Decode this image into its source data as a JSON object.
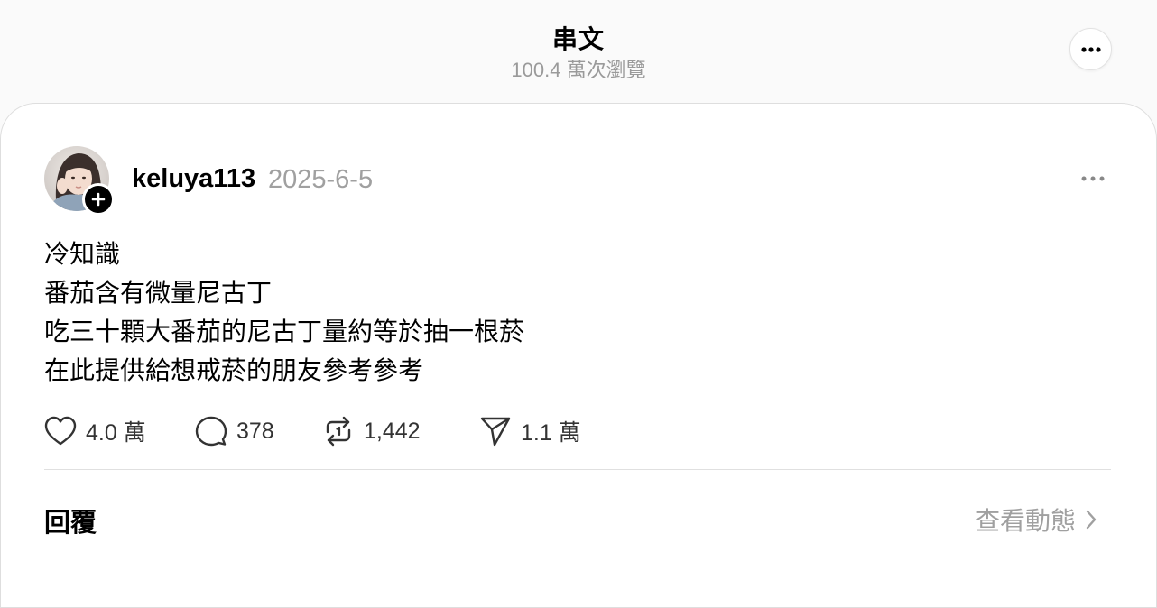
{
  "header": {
    "title": "串文",
    "views": "100.4 萬次瀏覽"
  },
  "post": {
    "username": "keluya113",
    "date": "2025-6-5",
    "lines": [
      "冷知識",
      "番茄含有微量尼古丁",
      "吃三十顆大番茄的尼古丁量約等於抽一根菸",
      "在此提供給想戒菸的朋友參考參考"
    ],
    "actions": {
      "likes": "4.0 萬",
      "comments": "378",
      "reposts": "1,442",
      "shares": "1.1 萬"
    }
  },
  "footer": {
    "replies_label": "回覆",
    "activity_label": "查看動態"
  },
  "icons": {
    "header_more": "more-horizontal-icon",
    "follow": "plus-icon",
    "post_more": "more-horizontal-icon",
    "like": "heart-icon",
    "comment": "comment-bubble-icon",
    "repost": "repost-icon",
    "share": "send-icon",
    "activity_arrow": "chevron-right-icon"
  },
  "colors": {
    "background": "#fafafa",
    "card": "#ffffff",
    "muted_text": "#a0a0a0"
  }
}
